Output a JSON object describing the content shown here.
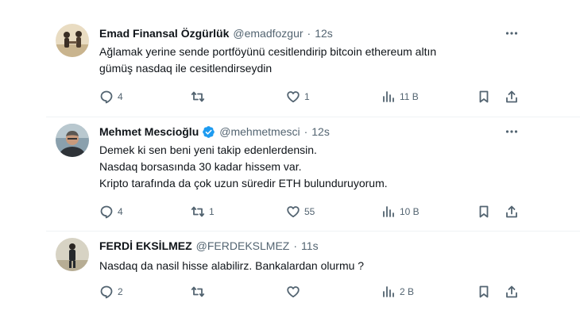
{
  "tweets": [
    {
      "name": "Emad Finansal Özgürlük",
      "handle": "@emadfozgur",
      "time": "12s",
      "verified": false,
      "text_lines": [
        "Ağlamak yerine sende portföyünü cesitlendirip bitcoin ethereum altın",
        "gümüş nasdaq ile cesitlendirseydin"
      ],
      "replies": "4",
      "retweets": "",
      "likes": "1",
      "views": "11 B"
    },
    {
      "name": "Mehmet Mescioğlu",
      "handle": "@mehmetmesci",
      "time": "12s",
      "verified": true,
      "text_lines": [
        "Demek ki sen beni yeni takip edenlerdensin.",
        "Nasdaq borsasında 30 kadar hissem var.",
        "Kripto tarafında da çok uzun süredir ETH bulunduruyorum."
      ],
      "replies": "4",
      "retweets": "1",
      "likes": "55",
      "views": "10 B"
    },
    {
      "name": "FERDİ EKSİLMEZ",
      "handle": "@FERDEKSLMEZ",
      "time": "11s",
      "verified": false,
      "text_lines": [
        "Nasdaq da nasil hisse alabilirz. Bankalardan olurmu ?"
      ],
      "replies": "2",
      "retweets": "",
      "likes": "",
      "views": "2 B"
    }
  ],
  "separator": "·",
  "colors": {
    "verified": "#1d9bf0",
    "muted": "#536471",
    "text": "#0f1419"
  },
  "icons": [
    "more-icon",
    "reply-icon",
    "retweet-icon",
    "like-icon",
    "views-icon",
    "bookmark-icon",
    "share-icon",
    "verified-icon"
  ]
}
